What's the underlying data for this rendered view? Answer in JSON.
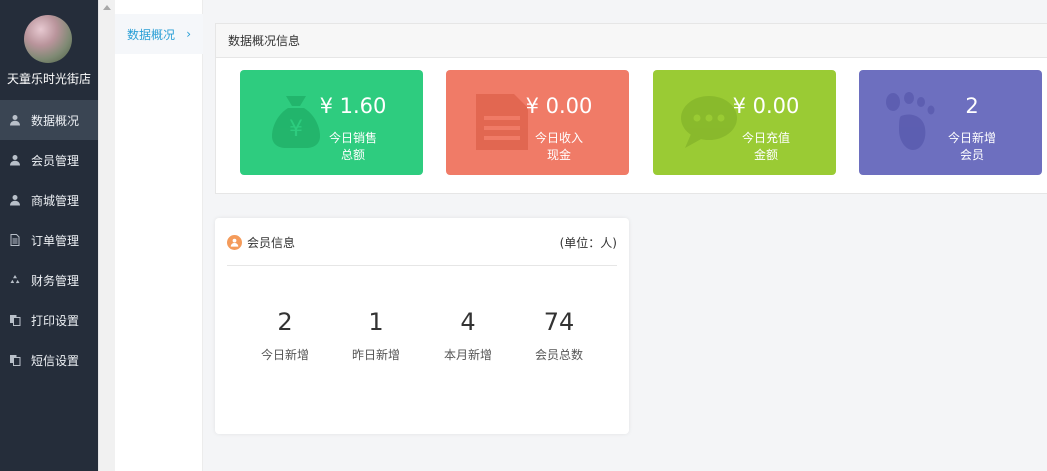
{
  "sidebar": {
    "store_name": "天童乐时光街店",
    "items": [
      {
        "label": "数据概况",
        "icon": "user-icon",
        "active": true
      },
      {
        "label": "会员管理",
        "icon": "user-icon"
      },
      {
        "label": "商城管理",
        "icon": "user-icon"
      },
      {
        "label": "订单管理",
        "icon": "document-icon"
      },
      {
        "label": "财务管理",
        "icon": "recycle-icon"
      },
      {
        "label": "打印设置",
        "icon": "copy-icon"
      },
      {
        "label": "短信设置",
        "icon": "copy-icon"
      }
    ]
  },
  "subnav": {
    "items": [
      {
        "label": "数据概况"
      }
    ]
  },
  "overview": {
    "title": "数据概况信息",
    "cards": [
      {
        "value": "¥ 1.60",
        "label_line1": "今日销售",
        "label_line2": "总额",
        "icon": "money-bag-icon",
        "color": "#2ecc7f"
      },
      {
        "value": "¥ 0.00",
        "label_line1": "今日收入",
        "label_line2": "现金",
        "icon": "document-icon",
        "color": "#f07b67"
      },
      {
        "value": "¥ 0.00",
        "label_line1": "今日充值",
        "label_line2": "金额",
        "icon": "chat-bubble-icon",
        "color": "#9acb34"
      },
      {
        "value": "2",
        "label_line1": "今日新增",
        "label_line2": "会员",
        "icon": "footprint-icon",
        "color": "#6d6fbf"
      }
    ]
  },
  "member": {
    "title": "会员信息",
    "unit": "(单位：人)",
    "stats": [
      {
        "value": "2",
        "label": "今日新增"
      },
      {
        "value": "1",
        "label": "昨日新增"
      },
      {
        "value": "4",
        "label": "本月新增"
      },
      {
        "value": "74",
        "label": "会员总数"
      }
    ]
  }
}
